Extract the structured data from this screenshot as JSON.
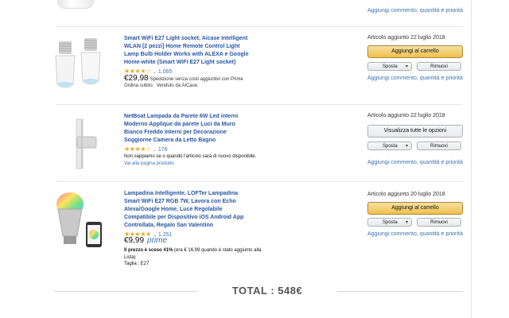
{
  "top_item": {
    "comment_link": "Aggiungi commento, quantità e priorità"
  },
  "items": [
    {
      "title": "Smart WiFi E27 Light socket, Aicase Intelligent WLAN [2 pezzi] Home Remote Control Light Lamp Bulb Holder Works with ALEXA e Google Home-white (Smart WiFi E27 Light socket)",
      "stars": 4,
      "rating_count": "1.065",
      "price": "€29,98",
      "shipping": "Spedizione senza costi aggiuntivi con Prime",
      "order_note": "Ordina subito.",
      "sold_by": "Venduto da AICase.",
      "added": "Articolo aggiunto 22 luglio 2018",
      "primary_button": "Aggiungi al carrello",
      "move_label": "Sposta",
      "remove_label": "Rimuovi",
      "comment_link": "Aggiungi commento, quantità e priorità"
    },
    {
      "title": "NetBoat Lampada da Parete 6W Led interni Moderno Applique da parete Luci da Muro Bianco Freddo Interni per Decorazione Soggiorne Camera da Letto Bagno",
      "stars": 4,
      "rating_count": "176",
      "availability": "Non sappiamo se o quando l'articolo sarà di nuovo disponibile.",
      "product_page_link": "Vai alla pagina prodotto.",
      "added": "Articolo aggiunto 22 luglio 2018",
      "primary_button": "Visualizza tutte le opzioni",
      "move_label": "Sposta",
      "remove_label": "Rimuovi",
      "comment_link": "Aggiungi commento, quantità e priorità"
    },
    {
      "title": "Lampadina Intelligente, LOFTer Lampadina Smart WiFi E27 RGB 7W, Lavora con Echo Alexa/Google Home, Luce Regolabile Compatibile per Dispositivo iOS Android App Controllata, Regalo San Valentino",
      "stars": 4.5,
      "rating_count": "1.251",
      "price": "€9,99",
      "prime": "prime",
      "price_drop": "Il prezzo è sceso 41%",
      "price_was": "(era € 16,99 quando è stato aggiunto alla Lista)",
      "size": "Taglia : E27",
      "added": "Articolo aggiunto 20 luglio 2018",
      "primary_button": "Aggiungi al carrello",
      "move_label": "Sposta",
      "remove_label": "Rimuovi",
      "comment_link": "Aggiungi commento, quantità e priorità"
    }
  ],
  "total": "TOTAL : 548€",
  "colors": {
    "link": "#3d72b4",
    "title": "#2756a5",
    "star": "#f0a41a",
    "cart_button": "#f0c14b"
  }
}
